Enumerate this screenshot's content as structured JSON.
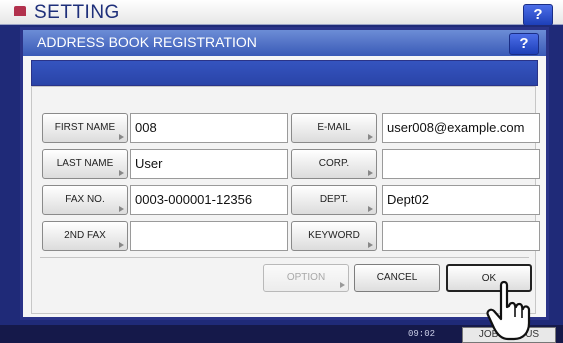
{
  "app": {
    "title": "SETTING",
    "help": "?"
  },
  "dialog": {
    "title": "ADDRESS BOOK REGISTRATION",
    "help": "?"
  },
  "left_fields": [
    {
      "label": "FIRST NAME",
      "value": "008"
    },
    {
      "label": "LAST NAME",
      "value": "User"
    },
    {
      "label": "FAX NO.",
      "value": "0003-000001-12356"
    },
    {
      "label": "2ND FAX",
      "value": ""
    }
  ],
  "right_fields": [
    {
      "label": "E-MAIL",
      "value": "user008@example.com"
    },
    {
      "label": "CORP.",
      "value": ""
    },
    {
      "label": "DEPT.",
      "value": "Dept02"
    },
    {
      "label": "KEYWORD",
      "value": ""
    }
  ],
  "actions": {
    "option": "OPTION",
    "cancel": "CANCEL",
    "ok": "OK"
  },
  "statusbar": {
    "time": "09:02",
    "jobs": "JOB STATUS"
  },
  "colors": {
    "dialog_border": "#2a3388",
    "title_bar": "#3a5ab7",
    "help_button": "#1d3fb8"
  },
  "icons": {
    "pointer": "hand-pointer-icon",
    "app": "setting-app-icon"
  }
}
